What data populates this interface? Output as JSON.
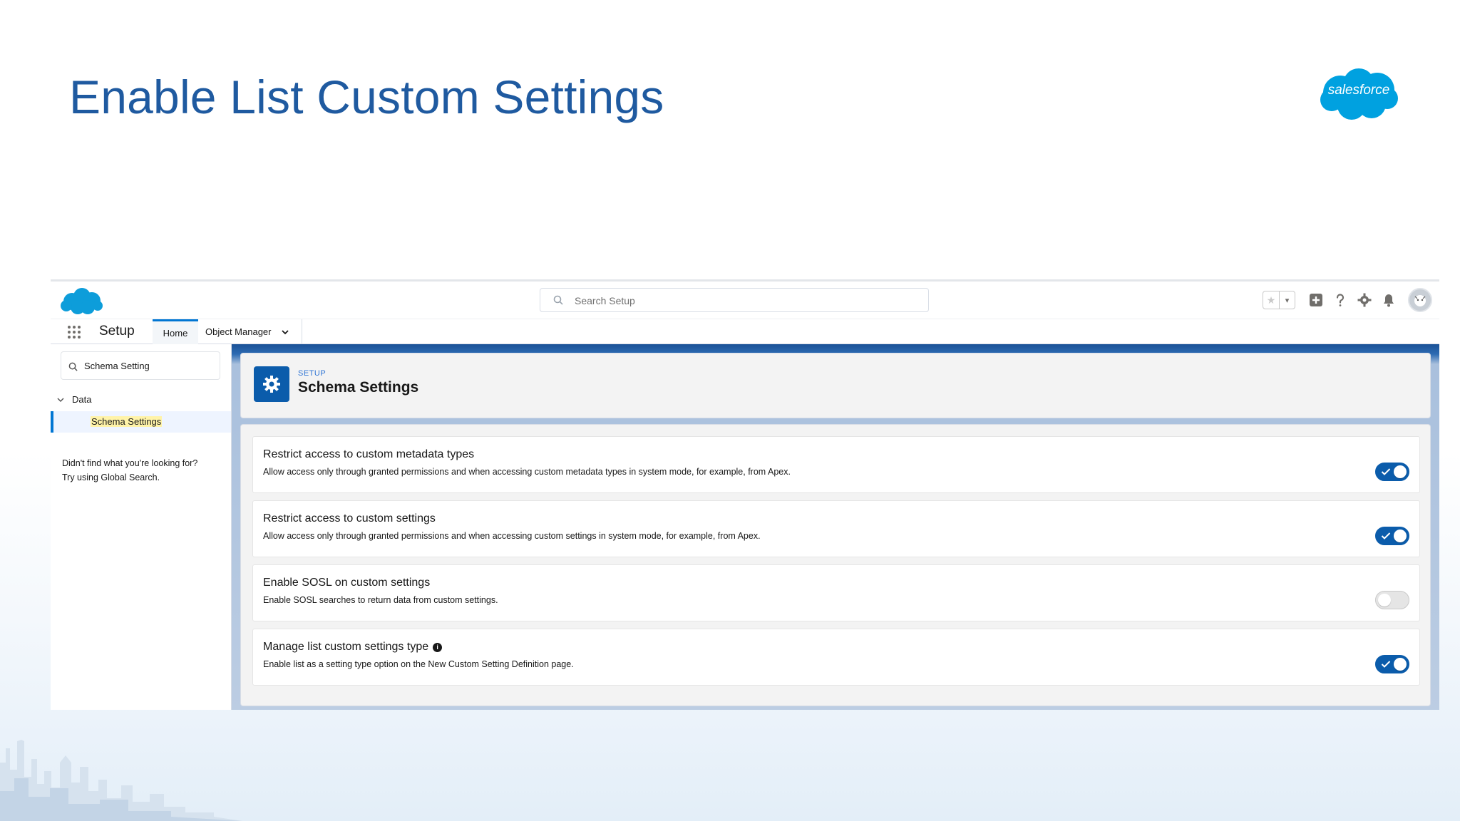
{
  "slide": {
    "title": "Enable List Custom Settings",
    "brand_logo_text": "salesforce"
  },
  "colors": {
    "slide_title": "#1f5aa0",
    "brand_blue": "#00a1e0",
    "toggle_on": "#0b5cab",
    "header_icon_bg": "#0b5cab"
  },
  "topbar": {
    "search_placeholder": "Search Setup",
    "icons": [
      "favorites-star-icon",
      "favorites-dropdown-icon",
      "global-actions-icon",
      "help-icon",
      "setup-gear-icon",
      "notifications-bell-icon",
      "user-avatar"
    ]
  },
  "navbar": {
    "app_name": "Setup",
    "tabs": [
      {
        "label": "Home",
        "active": true
      },
      {
        "label": "Object Manager",
        "active": false
      }
    ]
  },
  "sidebar": {
    "quickfind_value": "Schema Setting",
    "tree_section": "Data",
    "tree_item": "Schema Settings",
    "not_found_line1": "Didn't find what you're looking for?",
    "not_found_line2": "Try using Global Search."
  },
  "page_header": {
    "eyebrow": "SETUP",
    "title": "Schema Settings"
  },
  "settings": [
    {
      "title": "Restrict access to custom metadata types",
      "description": "Allow access only through granted permissions and when accessing custom metadata types in system mode, for example, from Apex.",
      "enabled": true
    },
    {
      "title": "Restrict access to custom settings",
      "description": "Allow access only through granted permissions and when accessing custom settings in system mode, for example, from Apex.",
      "enabled": true
    },
    {
      "title": "Enable SOSL on custom settings",
      "description": "Enable SOSL searches to return data from custom settings.",
      "enabled": false
    },
    {
      "title": "Manage list custom settings type",
      "description": "Enable list as a setting type option on the New Custom Setting Definition page.",
      "enabled": true,
      "has_info_icon": true,
      "info_icon_glyph": "i"
    }
  ]
}
